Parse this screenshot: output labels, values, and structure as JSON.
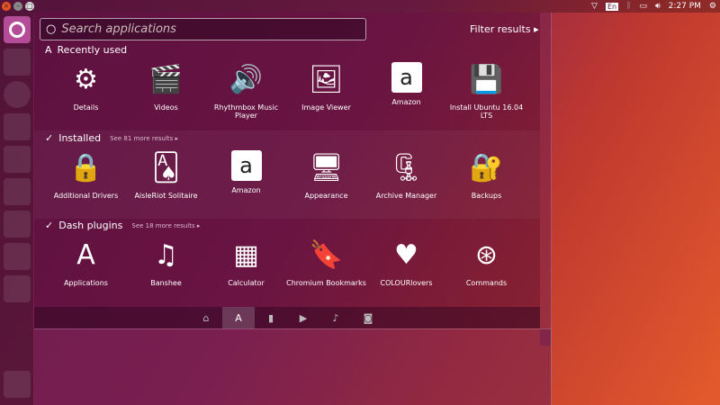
{
  "topbar": {
    "time": "2:27 PM",
    "keyboard": "En"
  },
  "search": {
    "placeholder": "Search applications"
  },
  "filter_label": "Filter results",
  "sections": [
    {
      "title": "Recently used",
      "more": "",
      "items": [
        {
          "label": "Details",
          "icon": "⚙"
        },
        {
          "label": "Videos",
          "icon": "🎬"
        },
        {
          "label": "Rhythmbox Music Player",
          "icon": "🔊"
        },
        {
          "label": "Image Viewer",
          "icon": "🖼"
        },
        {
          "label": "Amazon",
          "icon": "a"
        },
        {
          "label": "Install Ubuntu 16.04 LTS",
          "icon": "💾"
        }
      ]
    },
    {
      "title": "Installed",
      "more": "See 81 more results",
      "items": [
        {
          "label": "Additional Drivers",
          "icon": "🔒"
        },
        {
          "label": "AisleRiot Solitaire",
          "icon": "🂡"
        },
        {
          "label": "Amazon",
          "icon": "a"
        },
        {
          "label": "Appearance",
          "icon": "🖥"
        },
        {
          "label": "Archive Manager",
          "icon": "🗜"
        },
        {
          "label": "Backups",
          "icon": "🔐"
        }
      ]
    },
    {
      "title": "Dash plugins",
      "more": "See 18 more results",
      "items": [
        {
          "label": "Applications",
          "icon": "A"
        },
        {
          "label": "Banshee",
          "icon": "♫"
        },
        {
          "label": "Calculator",
          "icon": "▦"
        },
        {
          "label": "Chromium Bookmarks",
          "icon": "🔖"
        },
        {
          "label": "COLOURlovers",
          "icon": "♥"
        },
        {
          "label": "Commands",
          "icon": "⊛"
        }
      ]
    }
  ],
  "lenses": [
    {
      "name": "home",
      "icon": "⌂"
    },
    {
      "name": "applications",
      "icon": "A"
    },
    {
      "name": "files",
      "icon": "▮"
    },
    {
      "name": "video",
      "icon": "▶"
    },
    {
      "name": "music",
      "icon": "♪"
    },
    {
      "name": "photos",
      "icon": "◙"
    }
  ]
}
